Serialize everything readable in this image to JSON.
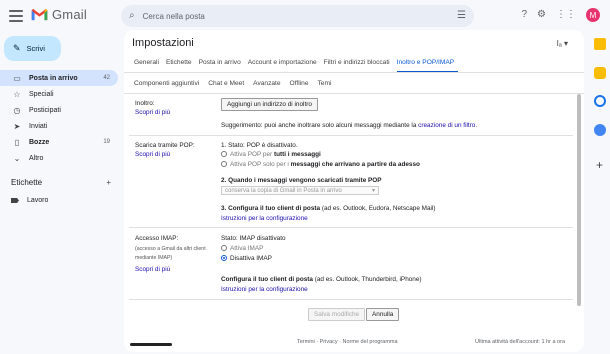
{
  "app": {
    "name": "Gmail"
  },
  "search": {
    "placeholder": "Cerca nella posta"
  },
  "account": {
    "initial": "M"
  },
  "compose": {
    "label": "Scrivi"
  },
  "nav": [
    {
      "label": "Posta in arrivo",
      "icon": "inbox-icon",
      "glyph": "▭",
      "count": "42",
      "bold": true
    },
    {
      "label": "Speciali",
      "icon": "star-icon",
      "glyph": "☆",
      "count": "",
      "bold": false
    },
    {
      "label": "Posticipati",
      "icon": "clock-icon",
      "glyph": "◷",
      "count": "",
      "bold": false
    },
    {
      "label": "Inviati",
      "icon": "send-icon",
      "glyph": "➤",
      "count": "",
      "bold": false
    },
    {
      "label": "Bozze",
      "icon": "draft-icon",
      "glyph": "▯",
      "count": "19",
      "bold": true
    },
    {
      "label": "Altro",
      "icon": "chevron-down-icon",
      "glyph": "⌄",
      "count": "",
      "bold": false
    }
  ],
  "labels": {
    "heading": "Etichette",
    "add": "+",
    "items": [
      "Lavoro"
    ]
  },
  "settings": {
    "title": "Impostazioni",
    "tabs_row1": [
      "Generali",
      "Etichette",
      "Posta in arrivo",
      "Account e importazione",
      "Filtri e indirizzi bloccati",
      "Inoltro e POP/IMAP"
    ],
    "tabs_row2": [
      "Componenti aggiuntivi",
      "Chat e Meet",
      "Avanzate",
      "Offline",
      "Temi"
    ],
    "active_tab": "Inoltro e POP/IMAP",
    "forwarding": {
      "label": "Inoltro:",
      "learn_more": "Scopri di più",
      "add_button": "Aggiungi un indirizzo di inoltro",
      "tip_text": "Suggerimento: puoi anche inoltrare solo alcuni messaggi mediante la",
      "tip_link": "creazione di un filtro",
      "tip_end": "."
    },
    "pop": {
      "label": "Scarica tramite POP:",
      "learn_more": "Scopri di più",
      "status": "1. Stato: POP è disattivato.",
      "opt1_pre": "Attiva POP per",
      "opt1_bold": "tutti i messaggi",
      "opt2_pre": "Attiva POP solo per i",
      "opt2_bold": "messaggi che arrivano a partire da adesso",
      "step2": "2. Quando i messaggi vengono scaricati tramite POP",
      "select_value": "conserva la copia di Gmail in Posta in arrivo",
      "step3": "3. Configura il tuo client di posta",
      "step3_note": "(ad es. Outlook, Eudora, Netscape Mail)",
      "instructions": "Istruzioni per la configurazione"
    },
    "imap": {
      "label": "Accesso IMAP:",
      "sublabel": "(accesso a Gmail da altri client mediante IMAP)",
      "learn_more": "Scopri di più",
      "status": "Stato: IMAP disattivato",
      "opt_on": "Attiva IMAP",
      "opt_off": "Disattiva IMAP",
      "configure": "Configura il tuo client di posta",
      "configure_note": "(ad es. Outlook, Thunderbird, iPhone)",
      "instructions": "Istruzioni per la configurazione"
    },
    "save_button": "Salva modifiche",
    "cancel_button": "Annulla"
  },
  "footer": {
    "links": "Termini · Privacy · Norme del programma",
    "activity": "Ultima attività dell'account: 1 hr a ora"
  },
  "colors": {
    "accent": "#0b57d0",
    "compose_bg": "#c2e7ff",
    "page_bg": "#f6f8fc",
    "avatar": "#e8336f"
  }
}
